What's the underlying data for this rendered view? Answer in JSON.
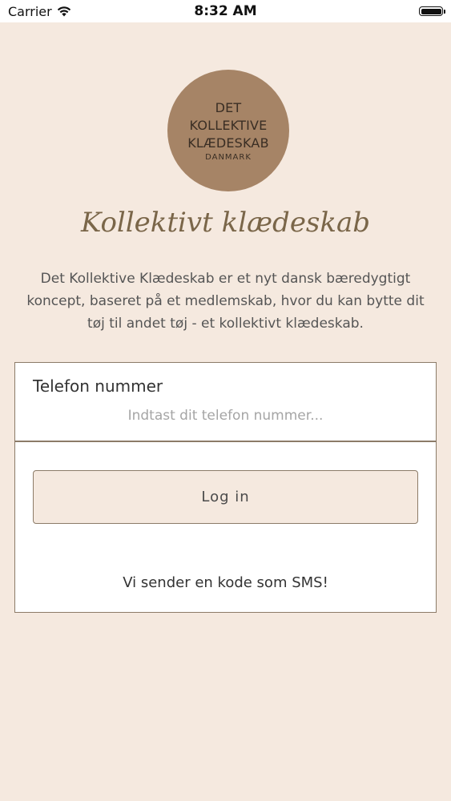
{
  "status_bar": {
    "carrier": "Carrier",
    "time": "8:32 AM",
    "battery_level": 1.0
  },
  "logo": {
    "line1": "DET",
    "line2": "KOLLEKTIVE",
    "line3": "KLÆDESKAB",
    "subline": "DANMARK",
    "circle_color": "#a68466"
  },
  "brand_name": "Kollektivt klædeskab",
  "description": "Det Kollektive Klædeskab er et nyt dansk bæredygtigt koncept, baseret på et medlemskab, hvor du kan bytte dit tøj til andet tøj - et kollektivt klædeskab.",
  "login_form": {
    "phone_label": "Telefon nummer",
    "phone_placeholder": "Indtast dit telefon nummer...",
    "phone_value": "",
    "login_button_label": "Log in",
    "sms_note": "Vi sender en kode som SMS!"
  },
  "colors": {
    "background": "#f5e9df",
    "accent": "#8c7b68"
  }
}
